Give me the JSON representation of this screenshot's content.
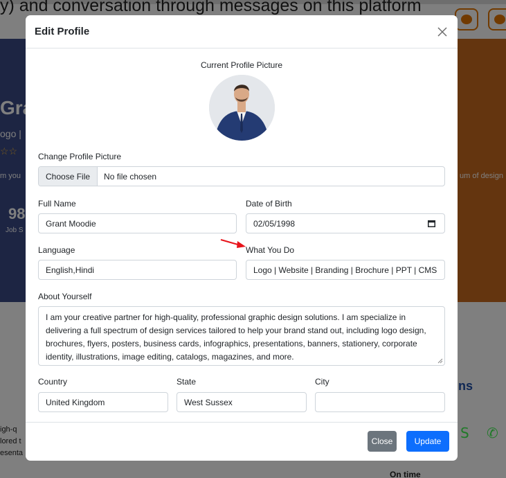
{
  "background": {
    "caption": "y) and conversation through messages on this platform",
    "hero_name": "Gra",
    "hero_tagline": "ogo |",
    "hero_stars": "☆☆",
    "hero_about_left": "m you",
    "hero_about_right": "um of design",
    "stat_number": "98",
    "stat_label": "Job S",
    "section_heading_tail": "ns",
    "lower_text": [
      "igh-q",
      "lored t",
      "esenta"
    ],
    "on_time_label": "On time"
  },
  "modal": {
    "title": "Edit Profile",
    "current_picture_label": "Current Profile Picture",
    "change_picture_label": "Change Profile Picture",
    "choose_file_button": "Choose File",
    "no_file_text": "No file chosen",
    "full_name_label": "Full Name",
    "full_name_value": "Grant Moodie",
    "dob_label": "Date of Birth",
    "dob_value": "02/05/1998",
    "language_label": "Language",
    "language_value": "English,Hindi",
    "what_you_do_label": "What You Do",
    "what_you_do_value": "Logo | Website | Branding | Brochure | PPT | CMS",
    "about_label": "About Yourself",
    "about_value": "I am your creative partner for high-quality, professional graphic design solutions. I am specialize in delivering a full spectrum of design services tailored to help your brand stand out, including logo design, brochures, flyers, posters, business cards, infographics, presentations, banners, stationery, corporate identity, illustrations, image editing, catalogs, magazines, and more.",
    "country_label": "Country",
    "country_value": "United Kingdom",
    "state_label": "State",
    "state_value": "West Sussex",
    "city_label": "City",
    "city_value": "",
    "close_button": "Close",
    "update_button": "Update"
  },
  "colors": {
    "primary": "#0d6efd",
    "secondary": "#6c757d",
    "accent_orange": "#e37400",
    "annotation_arrow": "#e8141b"
  },
  "icons": [
    "close-icon",
    "calendar-icon",
    "chat-icon",
    "bell-icon",
    "resize-handle-icon",
    "arrow-annotation"
  ]
}
